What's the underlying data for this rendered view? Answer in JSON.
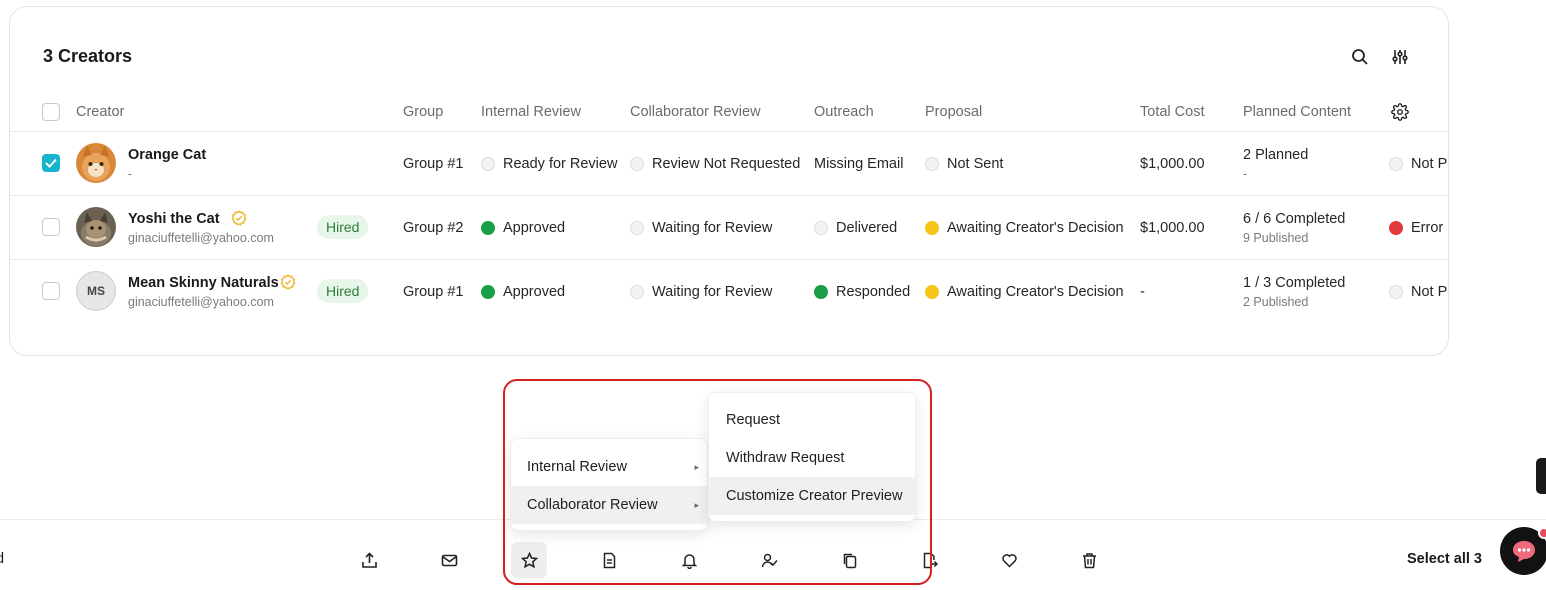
{
  "table": {
    "title": "3 Creators",
    "headers": {
      "creator": "Creator",
      "group": "Group",
      "internal_review": "Internal Review",
      "collaborator_review": "Collaborator Review",
      "outreach": "Outreach",
      "proposal": "Proposal",
      "total_cost": "Total Cost",
      "planned_content": "Planned Content"
    },
    "rows": [
      {
        "checked": true,
        "name": "Orange Cat",
        "email": "-",
        "status_badge": "",
        "group": "Group #1",
        "internal_review": "Ready for Review",
        "collaborator_review": "Review Not Requested",
        "outreach": "Missing Email",
        "proposal": "Not Sent",
        "total_cost": "$1,000.00",
        "planned_content": "2 Planned",
        "planned_sub": "-",
        "last_col": "Not P"
      },
      {
        "checked": false,
        "name": "Yoshi the Cat",
        "email": "ginaciuffetelli@yahoo.com",
        "status_badge": "Hired",
        "group": "Group #2",
        "internal_review": "Approved",
        "collaborator_review": "Waiting for Review",
        "outreach": "Delivered",
        "proposal": "Awaiting Creator's Decision",
        "total_cost": "$1,000.00",
        "planned_content": "6 / 6 Completed",
        "planned_sub": "9 Published",
        "last_col": "Error"
      },
      {
        "checked": false,
        "name": "Mean Skinny Naturals",
        "initials": "MS",
        "email": "ginaciuffetelli@yahoo.com",
        "status_badge": "Hired",
        "group": "Group #1",
        "internal_review": "Approved",
        "collaborator_review": "Waiting for Review",
        "outreach": "Responded",
        "proposal": "Awaiting Creator's Decision",
        "total_cost": "-",
        "planned_content": "1 / 3 Completed",
        "planned_sub": "2 Published",
        "last_col": "Not P"
      }
    ]
  },
  "menu": {
    "items": [
      "Internal Review",
      "Collaborator Review"
    ],
    "submenu": [
      "Request",
      "Withdraw Request",
      "Customize Creator Preview"
    ]
  },
  "bottom_bar": {
    "left_text": "d",
    "select_all": "Select all 3",
    "icons": [
      "export-icon",
      "mail-icon",
      "star-icon",
      "document-icon",
      "bell-icon",
      "user-check-icon",
      "copy-icon",
      "file-export-icon",
      "heart-icon",
      "trash-icon"
    ]
  },
  "colors": {
    "accent": "#17b3cf",
    "approved": "#1a9f48",
    "awaiting": "#f5c518",
    "error": "#e03a3a",
    "hired_bg": "#e8f6ea",
    "highlight": "#d61f1f"
  }
}
